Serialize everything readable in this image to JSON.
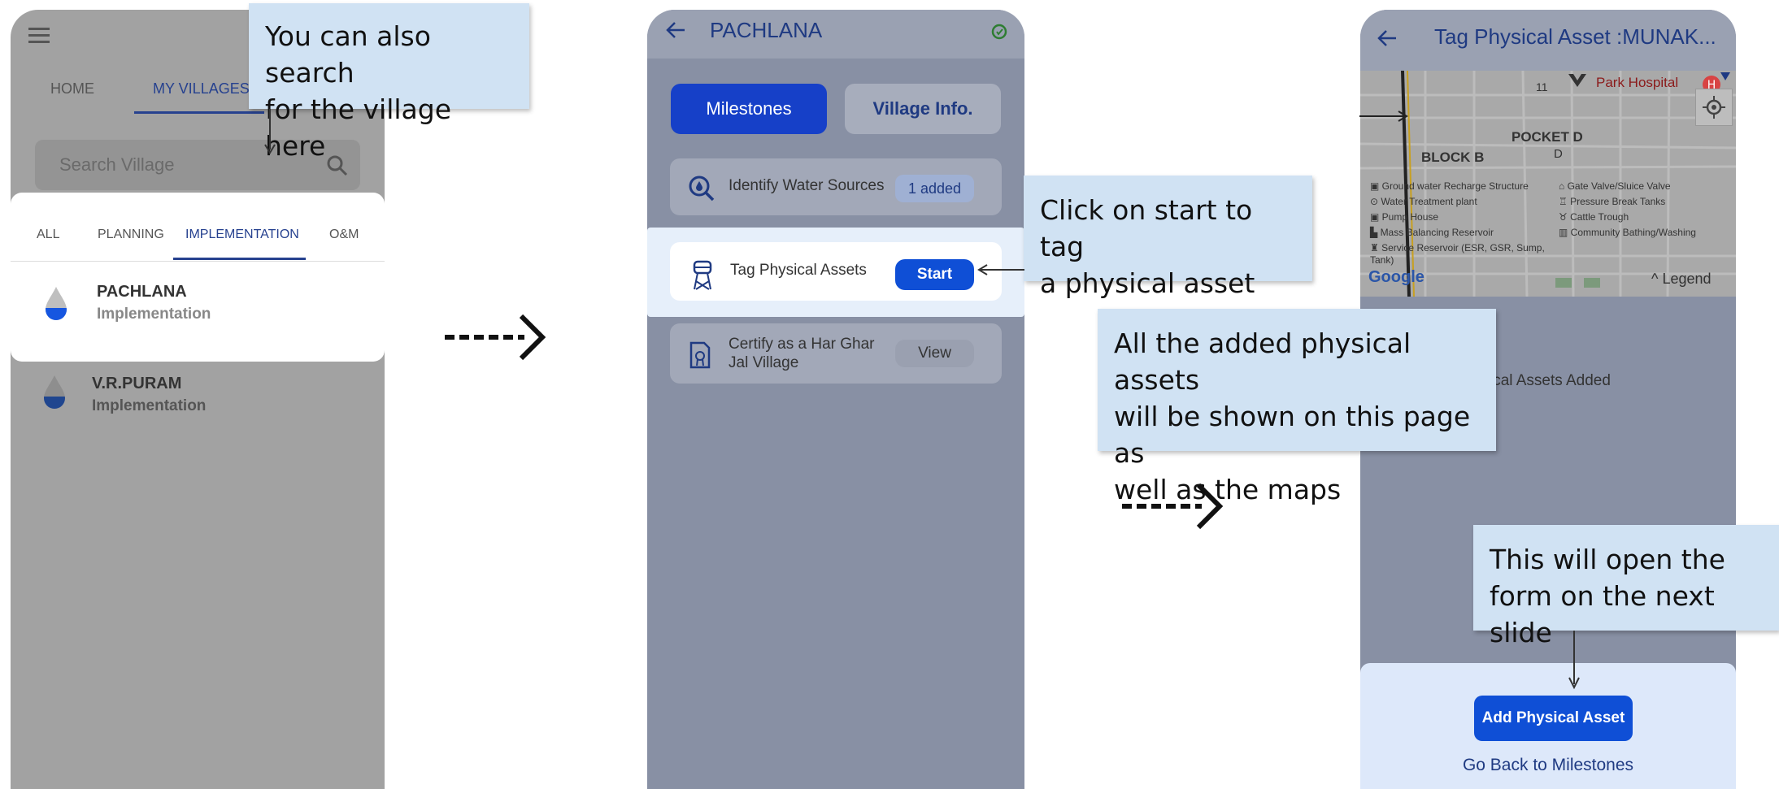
{
  "screen1": {
    "nav_tabs": [
      "HOME",
      "MY VILLAGES"
    ],
    "search": {
      "placeholder": "Search Village"
    },
    "filter_tabs": [
      "ALL",
      "PLANNING",
      "IMPLEMENTATION",
      "O&M"
    ],
    "villages": [
      {
        "name": "PACHLANA",
        "status": "Implementation"
      },
      {
        "name": "V.R.PURAM",
        "status": "Implementation"
      }
    ],
    "callout": "You can also search\nfor the village here"
  },
  "screen2": {
    "title": "PACHLANA",
    "tabs": {
      "milestones": "Milestones",
      "village_info": "Village Info."
    },
    "milestones": [
      {
        "label": "Identify Water Sources",
        "action": "1 added"
      },
      {
        "label": "Tag Physical Assets",
        "action": "Start"
      },
      {
        "label": "Certify as a Har Ghar Jal Village",
        "action": "View"
      }
    ],
    "callout": "Click on start to tag\na physical asset"
  },
  "screen3": {
    "title": "Tag Physical Asset :MUNAK...",
    "map": {
      "labels": [
        "Park Hospital",
        "POCKET D",
        "D",
        "BLOCK B",
        "11"
      ],
      "legend_left": [
        "Ground water Recharge Structure",
        "Water Treatment plant",
        "Pump House",
        "Mass Balancing Reservoir",
        "Service Reservoir (ESR, GSR, Sump, Tank)"
      ],
      "legend_right": [
        "Gate Valve/Sluice Valve",
        "Pressure Break Tanks",
        "Cattle Trough",
        "Community Bathing/Washing"
      ],
      "google": "Google",
      "legend_toggle": "Legend"
    },
    "empty_text": "ysical Assets Added",
    "add_button": "Add Physical Asset",
    "back_link": "Go Back to Milestones",
    "callout_assets": "All the added physical assets\nwill be shown on this page as\nwell as the maps",
    "callout_form": "This will open the\nform on the next slide"
  },
  "colors": {
    "primary": "#0f4fd6",
    "callout_bg": "#d0e2f3",
    "overlay_gray": "#a2a2a2",
    "overlay_slate": "#8890a4"
  }
}
